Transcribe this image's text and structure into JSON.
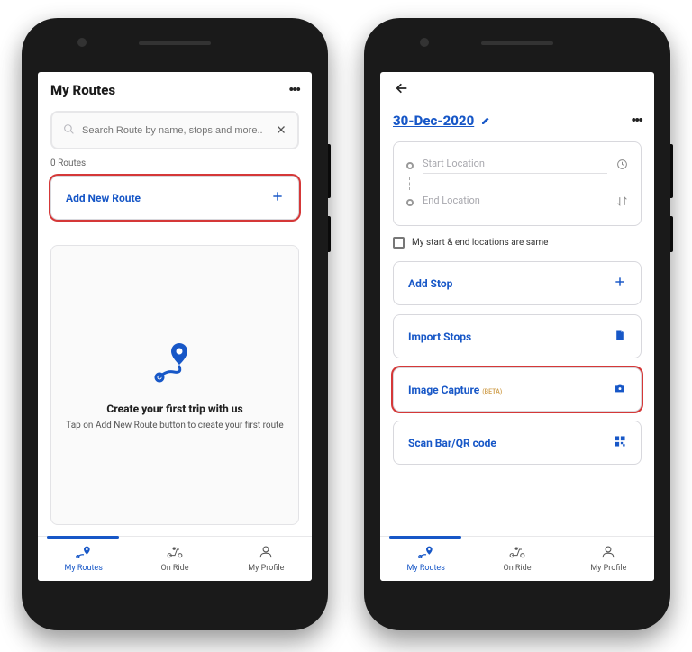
{
  "screen1": {
    "header_title": "My Routes",
    "search_placeholder": "Search Route by name, stops and more..",
    "routes_count": "0 Routes",
    "add_route_label": "Add New Route",
    "empty_title": "Create your first trip with us",
    "empty_subtitle": "Tap on Add New Route button to create your first route"
  },
  "screen2": {
    "date_title": "30-Dec-2020",
    "start_placeholder": "Start Location",
    "end_placeholder": "End Location",
    "same_loc_label": "My start & end locations are same",
    "buttons": {
      "add_stop": "Add Stop",
      "import_stops": "Import Stops",
      "image_capture": "Image Capture",
      "beta_tag": "(BETA)",
      "scan_code": "Scan Bar/QR code"
    }
  },
  "nav": {
    "my_routes": "My Routes",
    "on_ride": "On Ride",
    "my_profile": "My Profile"
  }
}
